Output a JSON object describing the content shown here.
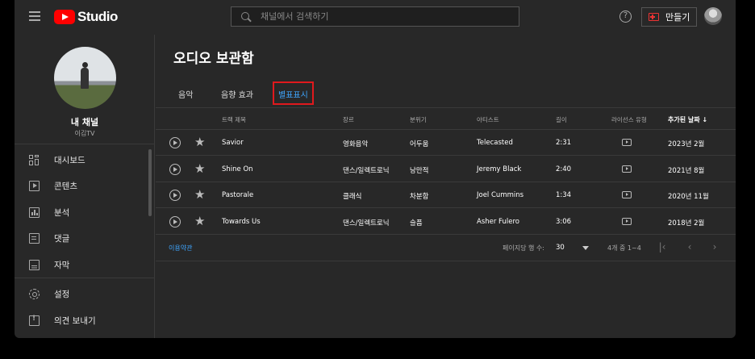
{
  "app": {
    "logo_text": "Studio",
    "search_placeholder": "채널에서 검색하기",
    "help_symbol": "?",
    "create_label": "만들기",
    "brand_color": "#ff0000",
    "accent_color": "#3ea6ff"
  },
  "sidebar": {
    "channel_name": "내 채널",
    "channel_handle": "이김TV",
    "items": [
      {
        "label": "대시보드",
        "icon": "dashboard-icon"
      },
      {
        "label": "콘텐츠",
        "icon": "content-icon"
      },
      {
        "label": "분석",
        "icon": "analytics-icon"
      },
      {
        "label": "댓글",
        "icon": "comments-icon"
      },
      {
        "label": "자막",
        "icon": "subtitles-icon"
      },
      {
        "label": "설정",
        "icon": "gear-icon"
      },
      {
        "label": "의견 보내기",
        "icon": "feedback-icon"
      }
    ]
  },
  "main": {
    "title": "오디오 보관함",
    "tabs": [
      {
        "label": "음악",
        "active": false
      },
      {
        "label": "음향 효과",
        "active": false
      },
      {
        "label": "별표표시",
        "active": true
      }
    ],
    "columns": {
      "title": "트랙 제목",
      "genre": "장르",
      "mood": "분위기",
      "artist": "아티스트",
      "length": "길이",
      "license": "라이선스 유형",
      "added": "추가된 날짜",
      "sort_arrow": "↓"
    },
    "rows": [
      {
        "title": "Savior",
        "genre": "영화음악",
        "mood": "어두움",
        "artist": "Telecasted",
        "length": "2:31",
        "added": "2023년 2월"
      },
      {
        "title": "Shine On",
        "genre": "댄스/일렉트로닉",
        "mood": "낭만적",
        "artist": "Jeremy Black",
        "length": "2:40",
        "added": "2021년 8월"
      },
      {
        "title": "Pastorale",
        "genre": "클래식",
        "mood": "차분함",
        "artist": "Joel Cummins",
        "length": "1:34",
        "added": "2020년 11월"
      },
      {
        "title": "Towards Us",
        "genre": "댄스/일렉트로닉",
        "mood": "슬픔",
        "artist": "Asher Fulero",
        "length": "3:06",
        "added": "2018년 2월"
      }
    ],
    "footer": {
      "terms": "이용약관",
      "rows_per_page_label": "페이지당 행 수:",
      "rows_per_page": "30",
      "range": "4개 중 1~4"
    },
    "pagination": {
      "first": "|‹",
      "prev": "‹",
      "next": "›"
    }
  }
}
